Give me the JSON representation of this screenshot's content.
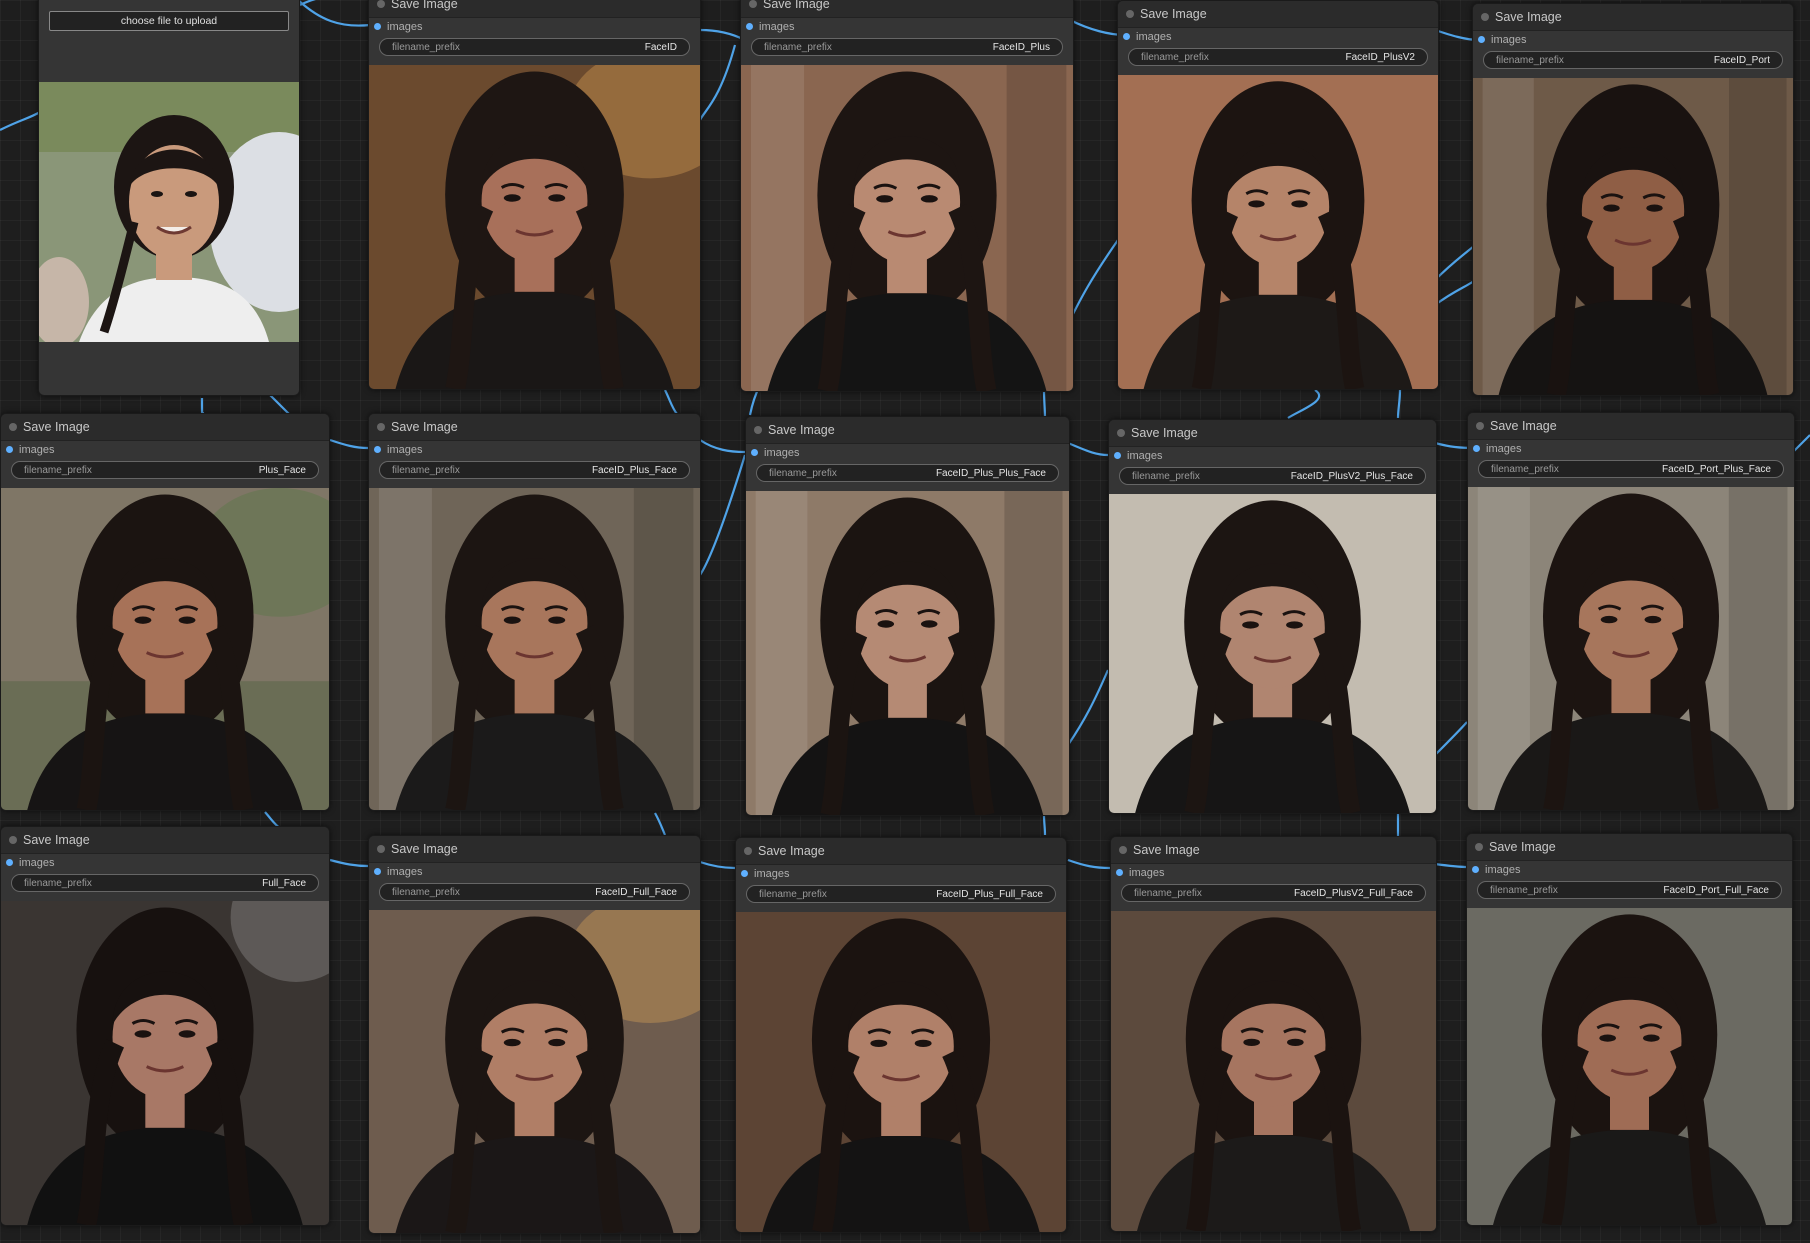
{
  "canvas": {
    "background": "#1e1e1e",
    "link_color": "#4fa3e8"
  },
  "load_node": {
    "upload_label": "choose file to upload",
    "scene": "outdoor",
    "skin": "#c99a7c",
    "cloth": "#eeeeee",
    "hair": "#1c1513"
  },
  "nodes": [
    {
      "id": "faceid",
      "title": "Save Image",
      "slot_label": "images",
      "widget_label": "filename_prefix",
      "widget_value": "FaceID",
      "bg": "#6b4a2e",
      "scene": "warm",
      "skin": "#a8705a",
      "cloth": "#1a1716",
      "hair": "#1e1613"
    },
    {
      "id": "faceid-plus",
      "title": "Save Image",
      "slot_label": "images",
      "widget_label": "filename_prefix",
      "widget_value": "FaceID_Plus",
      "bg": "#8a6650",
      "scene": "arch",
      "skin": "#b98a72",
      "cloth": "#141414",
      "hair": "#1d1512"
    },
    {
      "id": "faceid-plusv2",
      "title": "Save Image",
      "slot_label": "images",
      "widget_label": "filename_prefix",
      "widget_value": "FaceID_PlusV2",
      "bg": "#a36f53",
      "scene": "plain",
      "skin": "#b58469",
      "cloth": "#1d1917",
      "hair": "#1c1411"
    },
    {
      "id": "faceid-port",
      "title": "Save Image",
      "slot_label": "images",
      "widget_label": "filename_prefix",
      "widget_value": "FaceID_Port",
      "bg": "#6e5a48",
      "scene": "arch",
      "skin": "#8f5e45",
      "cloth": "#151312",
      "hair": "#191210"
    },
    {
      "id": "plus-face",
      "title": "Save Image",
      "slot_label": "images",
      "widget_label": "filename_prefix",
      "widget_value": "Plus_Face",
      "bg": "#7f7666",
      "scene": "outdoor",
      "skin": "#a77258",
      "cloth": "#161414",
      "hair": "#1b1411"
    },
    {
      "id": "faceid-plus-face",
      "title": "Save Image",
      "slot_label": "images",
      "widget_label": "filename_prefix",
      "widget_value": "FaceID_Plus_Face",
      "bg": "#6f6558",
      "scene": "arch",
      "skin": "#a8765c",
      "cloth": "#1b1a1a",
      "hair": "#1c1512"
    },
    {
      "id": "faceid-plus-plus-face",
      "title": "Save Image",
      "slot_label": "images",
      "widget_label": "filename_prefix",
      "widget_value": "FaceID_Plus_Plus_Face",
      "bg": "#8e7a68",
      "scene": "arch",
      "skin": "#b58a74",
      "cloth": "#141313",
      "hair": "#1b1411"
    },
    {
      "id": "faceid-plusv2-plus-face",
      "title": "Save Image",
      "slot_label": "images",
      "widget_label": "filename_prefix",
      "widget_value": "FaceID_PlusV2_Plus_Face",
      "bg": "#c3bcb0",
      "scene": "plain",
      "skin": "#b08570",
      "cloth": "#161515",
      "hair": "#1c1512"
    },
    {
      "id": "faceid-port-plus-face",
      "title": "Save Image",
      "slot_label": "images",
      "widget_label": "filename_prefix",
      "widget_value": "FaceID_Port_Plus_Face",
      "bg": "#8c8579",
      "scene": "arch",
      "skin": "#a7765c",
      "cloth": "#1a1817",
      "hair": "#1c1411"
    },
    {
      "id": "full-face",
      "title": "Save Image",
      "slot_label": "images",
      "widget_label": "filename_prefix",
      "widget_value": "Full_Face",
      "bg": "#3a3532",
      "scene": "dark",
      "skin": "#a87866",
      "cloth": "#111111",
      "hair": "#17110f"
    },
    {
      "id": "faceid-full-face",
      "title": "Save Image",
      "slot_label": "images",
      "widget_label": "filename_prefix",
      "widget_value": "FaceID_Full_Face",
      "bg": "#6e5c4e",
      "scene": "warm",
      "skin": "#b07e66",
      "cloth": "#1b1717",
      "hair": "#1c1512"
    },
    {
      "id": "faceid-plus-full-face",
      "title": "Save Image",
      "slot_label": "images",
      "widget_label": "filename_prefix",
      "widget_value": "FaceID_Plus_Full_Face",
      "bg": "#5c4434",
      "scene": "plain",
      "skin": "#b08069",
      "cloth": "#141313",
      "hair": "#1b1310"
    },
    {
      "id": "faceid-plusv2-full-face",
      "title": "Save Image",
      "slot_label": "images",
      "widget_label": "filename_prefix",
      "widget_value": "FaceID_PlusV2_Full_Face",
      "bg": "#5c4a3d",
      "scene": "plain",
      "skin": "#a67560",
      "cloth": "#1c1a19",
      "hair": "#1b1310"
    },
    {
      "id": "faceid-port-full-face",
      "title": "Save Image",
      "slot_label": "images",
      "widget_label": "filename_prefix",
      "widget_value": "FaceID_Port_Full_Face",
      "bg": "#6b6a62",
      "scene": "plain",
      "skin": "#9f6c55",
      "cloth": "#1a1918",
      "hair": "#1b1310"
    }
  ]
}
